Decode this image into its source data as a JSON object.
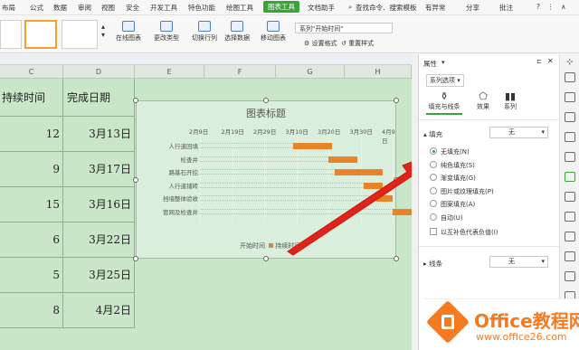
{
  "menu": {
    "items": [
      "布局",
      "公式",
      "数据",
      "审阅",
      "视图",
      "安全",
      "开发工具",
      "特色功能",
      "绘图工具",
      "图表工具",
      "文档助手"
    ],
    "active": "图表工具",
    "search": "查找命令、搜索模板",
    "right": [
      "有异常",
      "分享",
      "批注"
    ]
  },
  "ribbon": {
    "online_chart": "在线图表",
    "change_type": "更改类型",
    "switch_rowcol": "切换行列",
    "select_data": "选择数据",
    "move_chart": "移动图表",
    "series_select": "系列\"开始时间\"",
    "set_format": "设置格式",
    "reset_style": "重置样式"
  },
  "sheet": {
    "columns": [
      "C",
      "D",
      "E",
      "F",
      "G",
      "H"
    ],
    "header_c": "持续时间",
    "header_d": "完成日期",
    "rows": [
      {
        "c": "12",
        "d": "3月13日"
      },
      {
        "c": "9",
        "d": "3月17日"
      },
      {
        "c": "15",
        "d": "3月16日"
      },
      {
        "c": "6",
        "d": "3月22日"
      },
      {
        "c": "5",
        "d": "3月25日"
      },
      {
        "c": "8",
        "d": "4月2日"
      }
    ]
  },
  "chart_data": {
    "type": "bar",
    "title": "图表标题",
    "x_ticks": [
      "2月9日",
      "2月19日",
      "2月29日",
      "3月10日",
      "3月20日",
      "3月30日",
      "4月9日"
    ],
    "categories": [
      "人行道回填",
      "检查井",
      "路基石开挖",
      "人行道铺砖",
      "挡墙整体验收",
      "管网及检查井"
    ],
    "series": [
      {
        "name": "开始时间",
        "values": [
          29,
          40,
          42,
          51,
          55,
          60
        ],
        "color": "none"
      },
      {
        "name": "持续时间",
        "values": [
          12,
          9,
          15,
          6,
          5,
          8
        ],
        "color": "#e8832a"
      }
    ],
    "xlim": [
      0,
      60
    ],
    "x_unit": "days from 2月9日",
    "legend": "bottom"
  },
  "panel": {
    "title": "属性",
    "series_tab": "系列选项",
    "tabs": [
      "填充与线条",
      "效果",
      "系列"
    ],
    "fill_section": "填充",
    "fill_value": "无",
    "options": [
      "无填充(N)",
      "纯色填充(S)",
      "渐变填充(G)",
      "图片或纹理填充(P)",
      "图案填充(A)",
      "自动(U)"
    ],
    "selected_option": 0,
    "invert_label": "以互补色代表负值(I)",
    "line_section": "线条",
    "line_value": "无"
  },
  "watermark": {
    "brand": "Office教程网",
    "url": "www.office26.com"
  }
}
